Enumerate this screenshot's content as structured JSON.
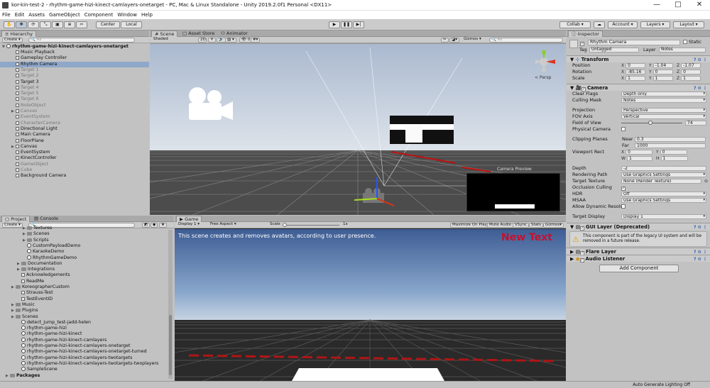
{
  "window": {
    "title": "kor-kin-test-2 - rhythm-game-hizi-kinect-camlayers-onetarget - PC, Mac & Linux Standalone - Unity 2019.2.0f1 Personal <DX11>"
  },
  "menu": [
    "File",
    "Edit",
    "Assets",
    "GameObject",
    "Component",
    "Window",
    "Help"
  ],
  "toolbar": {
    "center": "Center",
    "local": "Local",
    "collab": "Collab",
    "account": "Account",
    "layers": "Layers",
    "layout": "Layout"
  },
  "hierarchy": {
    "tab": "Hierarchy",
    "create": "Create",
    "search": "All",
    "scene": "rhythm-game-hizi-kinect-camlayers-onetarget",
    "items": [
      {
        "label": "Music Playback",
        "indent": 1,
        "dim": false,
        "arrow": false
      },
      {
        "label": "Gameplay Controller",
        "indent": 1,
        "dim": false,
        "arrow": false
      },
      {
        "label": "Rhythm Camera",
        "indent": 1,
        "dim": false,
        "arrow": false,
        "selected": true
      },
      {
        "label": "Target 1",
        "indent": 1,
        "dim": true,
        "arrow": false
      },
      {
        "label": "Target 2",
        "indent": 1,
        "dim": true,
        "arrow": false
      },
      {
        "label": "Target 3",
        "indent": 1,
        "dim": false,
        "arrow": false
      },
      {
        "label": "Target 4",
        "indent": 1,
        "dim": true,
        "arrow": false
      },
      {
        "label": "Target 5",
        "indent": 1,
        "dim": true,
        "arrow": false
      },
      {
        "label": "Target 6",
        "indent": 1,
        "dim": true,
        "arrow": false
      },
      {
        "label": "NoteObject",
        "indent": 1,
        "dim": true,
        "arrow": false
      },
      {
        "label": "Canvas",
        "indent": 1,
        "dim": true,
        "arrow": true
      },
      {
        "label": "EventSystem",
        "indent": 1,
        "dim": true,
        "arrow": false
      },
      {
        "label": "CharacterCamera",
        "indent": 1,
        "dim": true,
        "arrow": false
      },
      {
        "label": "Directional Light",
        "indent": 1,
        "dim": false,
        "arrow": false
      },
      {
        "label": "Main Camera",
        "indent": 1,
        "dim": false,
        "arrow": false
      },
      {
        "label": "FloorPlane",
        "indent": 1,
        "dim": false,
        "arrow": false
      },
      {
        "label": "Canvas",
        "indent": 1,
        "dim": false,
        "arrow": true
      },
      {
        "label": "EventSystem",
        "indent": 1,
        "dim": false,
        "arrow": false
      },
      {
        "label": "KinectController",
        "indent": 1,
        "dim": false,
        "arrow": false
      },
      {
        "label": "GameObject",
        "indent": 1,
        "dim": true,
        "arrow": false
      },
      {
        "label": "Cube",
        "indent": 1,
        "dim": true,
        "arrow": false
      },
      {
        "label": "Background Camera",
        "indent": 1,
        "dim": false,
        "arrow": false
      }
    ]
  },
  "scene_view": {
    "tabs": [
      "Scene",
      "Asset Store",
      "Animator"
    ],
    "shading": "Shaded",
    "mode2d": "2D",
    "gizmos": "Gizmos",
    "search": "All",
    "camera_preview": "Camera Preview",
    "persp": "< Persp"
  },
  "project": {
    "tabs": [
      "Project",
      "Console"
    ],
    "create": "Create",
    "items": [
      {
        "label": "Textures",
        "indent": 3,
        "icon": "folder",
        "arrow": true
      },
      {
        "label": "Scenes",
        "indent": 3,
        "icon": "folder",
        "arrow": true
      },
      {
        "label": "Scripts",
        "indent": 3,
        "icon": "folder",
        "arrow": true
      },
      {
        "label": "CustomPayloadDemo",
        "indent": 3,
        "icon": "scene",
        "arrow": false
      },
      {
        "label": "KaraokeDemo",
        "indent": 3,
        "icon": "scene",
        "arrow": false
      },
      {
        "label": "RhythmGameDemo",
        "indent": 3,
        "icon": "scene",
        "arrow": false
      },
      {
        "label": "Documentation",
        "indent": 2,
        "icon": "folder",
        "arrow": true
      },
      {
        "label": "Integrations",
        "indent": 2,
        "icon": "folder",
        "arrow": true
      },
      {
        "label": "Acknowledgements",
        "indent": 2,
        "icon": "file",
        "arrow": false
      },
      {
        "label": "ReadMe",
        "indent": 2,
        "icon": "file",
        "arrow": false
      },
      {
        "label": "KoreographerCustom",
        "indent": 1,
        "icon": "folder",
        "arrow": true
      },
      {
        "label": "Strauss-Test",
        "indent": 2,
        "icon": "file",
        "arrow": false
      },
      {
        "label": "TestEventID",
        "indent": 2,
        "icon": "file",
        "arrow": false
      },
      {
        "label": "Music",
        "indent": 1,
        "icon": "folder",
        "arrow": true
      },
      {
        "label": "Plugins",
        "indent": 1,
        "icon": "folder",
        "arrow": true
      },
      {
        "label": "Scenes",
        "indent": 1,
        "icon": "folder",
        "arrow": true
      },
      {
        "label": "detect_jump_test-jadd-helen",
        "indent": 2,
        "icon": "scene",
        "arrow": false
      },
      {
        "label": "rhythm-game-hizi",
        "indent": 2,
        "icon": "scene",
        "arrow": false
      },
      {
        "label": "rhythm-game-hizi-kinect",
        "indent": 2,
        "icon": "scene",
        "arrow": false
      },
      {
        "label": "rhythm-game-hizi-kinect-camlayers",
        "indent": 2,
        "icon": "scene",
        "arrow": false
      },
      {
        "label": "rhythm-game-hizi-kinect-camlayers-onetarget",
        "indent": 2,
        "icon": "scene",
        "arrow": false
      },
      {
        "label": "rhythm-game-hizi-kinect-camlayers-onetarget-turned",
        "indent": 2,
        "icon": "scene",
        "arrow": false
      },
      {
        "label": "rhythm-game-hizi-kinect-camlayers-twotargets",
        "indent": 2,
        "icon": "scene",
        "arrow": false
      },
      {
        "label": "rhythm-game-hizi-kinect-camlayers-twotargets-twoplayers",
        "indent": 2,
        "icon": "scene",
        "arrow": false
      },
      {
        "label": "SampleScene",
        "indent": 2,
        "icon": "scene",
        "arrow": false
      },
      {
        "label": "Packages",
        "indent": 0,
        "icon": "folder",
        "arrow": true,
        "bold": true
      }
    ]
  },
  "game_view": {
    "tab": "Game",
    "display": "Display 1",
    "aspect": "Free Aspect",
    "scale_label": "Scale",
    "scale_value": "1x",
    "buttons": [
      "Maximize On Play",
      "Mute Audio",
      "VSync",
      "Stats",
      "Gizmos"
    ],
    "presence_text": "This scene creates and removes avatars, according to user presence.",
    "new_text": "New Text"
  },
  "inspector": {
    "tab": "Inspector",
    "object_name": "Rhythm Camera",
    "static": "Static",
    "tag_label": "Tag",
    "tag": "Untagged",
    "layer_label": "Layer",
    "layer": "Notes",
    "transform": {
      "title": "Transform",
      "position": [
        "0",
        "-1.04",
        "-1.07"
      ],
      "rotation": [
        "-85.16",
        "0",
        "0"
      ],
      "scale": [
        "1",
        "1",
        "1"
      ],
      "labels": [
        "Position",
        "Rotation",
        "Scale"
      ]
    },
    "camera": {
      "title": "Camera",
      "rows": [
        {
          "label": "Clear Flags",
          "value": "Depth only",
          "dd": true
        },
        {
          "label": "Culling Mask",
          "value": "Notes",
          "dd": true
        },
        {
          "label": "Projection",
          "value": "Perspective",
          "dd": true
        },
        {
          "label": "FOV Axis",
          "value": "Vertical",
          "dd": true
        }
      ],
      "fov_label": "Field of View",
      "fov": "74",
      "physical_label": "Physical Camera",
      "clipping_label": "Clipping Planes",
      "near_label": "Near",
      "near": "0.3",
      "far_label": "Far",
      "far": "1000",
      "viewport_label": "Viewport Rect",
      "vx": "0",
      "vy": "0",
      "vw": "1",
      "vh": "1",
      "depth_label": "Depth",
      "depth": "-2",
      "rendering_label": "Rendering Path",
      "rendering": "Use Graphics Settings",
      "target_tex_label": "Target Texture",
      "target_tex": "None (Render Texture)",
      "occlusion_label": "Occlusion Culling",
      "hdr_label": "HDR",
      "hdr": "Off",
      "msaa_label": "MSAA",
      "msaa": "Use Graphics Settings",
      "dynres_label": "Allow Dynamic Resolution",
      "target_display_label": "Target Display",
      "target_display": "Display 1"
    },
    "gui_layer": {
      "title": "GUI Layer (Deprecated)",
      "warning": "This component is part of the legacy UI system and will be removed in a future release."
    },
    "flare_layer": "Flare Layer",
    "audio_listener": "Audio Listener",
    "add_component": "Add Component"
  },
  "statusbar": {
    "text": "Auto Generate Lighting Off"
  },
  "colors": {
    "accent": "#3d6fb6",
    "selected_row": "#8fa7c9",
    "new_text": "#c8102e",
    "scene_sky": "#dfe8f3",
    "game_floor": "#2a2a2a"
  }
}
